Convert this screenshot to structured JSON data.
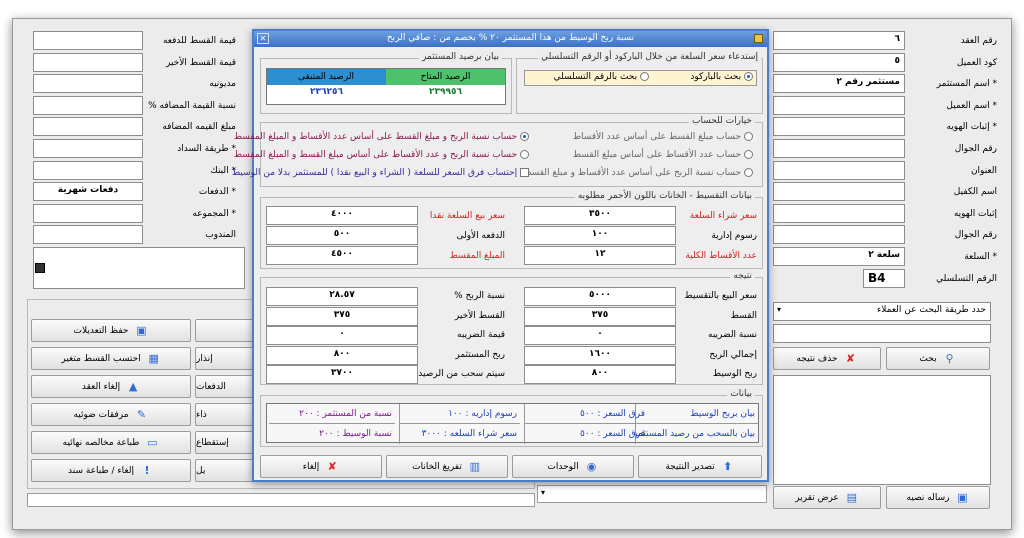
{
  "form": {
    "right_labels": [
      "رقم العقد",
      "كود العميل",
      "* اسم المستثمر",
      "* اسم العميل",
      "* إثبات الهويه",
      "رقم الجوال",
      "العنوان",
      "اسم الكفيل",
      "إثبات الهويه",
      "رقم الجوال",
      "* السلعة",
      "الرقم التسلسلي"
    ],
    "right_values": [
      "٦",
      "٥",
      "مستثمر رقم ٢",
      "",
      "",
      "",
      "",
      "",
      "",
      "",
      "سلعة ٢",
      "B4"
    ],
    "left_labels": [
      "قيمة القسط للدفعه",
      "قيمة القسط الأخير",
      "مديونيه",
      "نسبة القيمة المضافه %",
      "مبلغ القيمه المضافه",
      "* طريقة السداد",
      "* البنك",
      "* الدفعات",
      "* المجموعه",
      "المندوب"
    ],
    "left_values": [
      "",
      "",
      "",
      "",
      "",
      "",
      "",
      "دفعات شهرية",
      "",
      ""
    ],
    "search_method_placeholder": "حدد طريقة البحث عن العملاء",
    "search_button": "بحث",
    "delete_result_button": "حذف نتيجه",
    "send_message_button": "رساله نصيه",
    "show_report_button": "عرض تقرير"
  },
  "left_buttons": {
    "col1": [
      "حفظ التعديلات",
      "احتسب القسط متغير",
      "إلغاء العقد",
      "مرفقات ضوئيه",
      "طباعة مخالصه نهائيه",
      "إلغاء / طباعة سند"
    ],
    "col2": [
      "",
      "إنذار",
      "الدفعات",
      "ذاء",
      "إستقطاع",
      "يل"
    ]
  },
  "dialog": {
    "title": "نسبة ربح الوسيط من هذا المستثمر ٢٠ % بخصم من : صافي الربح",
    "serial_group": {
      "title": "إستدعاء سعر السلعة من خلال الباركود أو الرقم التسلسلي",
      "opt_barcode": "بحث بالباركود",
      "opt_serial": "بحث بالرقم التسلسلي"
    },
    "balance_group": {
      "title": "بيان برصيد المستثمر",
      "available_label": "الرصيد المتاح",
      "remaining_label": "الرصيد المتبقى",
      "available": "٢٣٩٩٥٦",
      "remaining": "٢٣٦٢٥٦"
    },
    "options_group": {
      "title": "خيارات للحساب",
      "opts": [
        "حساب مبلغ القسط على أساس عدد الأقساط",
        "حساب عدد الأقساط على أساس مبلغ القسط",
        "حساب نسبة الربح على أساس عدد الأقساط و مبلغ القسط",
        "حساب نسبة الربح و مبلغ القسط على أساس عدد الأقساط و المبلغ المقسط",
        "حساب نسبة الربح و عدد الأقساط على أساس مبلغ القسط و المبلغ المقسط",
        "إحتساب فرق السعر للسلعة ( الشراء و البيع نقدا ) للمستثمر بدلا من الوسيط"
      ]
    },
    "installment_group": {
      "title": "بيانات التقسيط - الخانات باللون الأحمر مطلوبه",
      "purchase_price_label": "سعر شراء السلعة",
      "purchase_price": "٣٥٠٠",
      "admin_fee_label": "رسوم إدارية",
      "admin_fee": "١٠٠",
      "count_label": "عدد الأقساط الكلية",
      "count": "١٢",
      "cash_price_label": "سعر بيع السلعة نقدا",
      "cash_price": "٤٠٠٠",
      "first_payment_label": "الدفعه الأولى",
      "first_payment": "٥٠٠",
      "financed_label": "المبلغ المقسط",
      "financed": "٤٥٠٠"
    },
    "result_group": {
      "title": "نتيجه",
      "sale_price_label": "سعر البيع بالتقسيط",
      "sale_price": "٥٠٠٠",
      "installment_label": "القسط",
      "installment": "٣٧٥",
      "tax_rate_label": "نسبة الضريبه",
      "tax_rate": "٠",
      "total_profit_label": "إجمالي الربح",
      "total_profit": "١٦٠٠",
      "broker_profit_label": "ربح الوسيط",
      "broker_profit": "٨٠٠",
      "profit_pct_label": "نسبة الربح %",
      "profit_pct": "٢٨.٥٧",
      "last_installment_label": "القسط الأخير",
      "last_installment": "٣٧٥",
      "tax_value_label": "قيمة الضريبه",
      "tax_value": "٠",
      "investor_profit_label": "ربح المستثمر",
      "investor_profit": "٨٠٠",
      "withdraw_label": "سيتم سحب من الرصيد",
      "withdraw": "٣٧٠٠"
    },
    "data_group": {
      "title": "بيانات",
      "row1": [
        "بيان بربح الوسيط",
        "فرق السعر : ٥٠٠",
        "رسوم إداريه : ١٠٠",
        "نسبة من المستثمر : ٢٠٠"
      ],
      "row2": [
        "بيان بالسحب من رصيد المستثمر",
        "فرق السعر : ٥٠٠",
        "سعر شراء السلعه : ٣٠٠٠",
        "نسبة الوسيط : ٢٠٠"
      ]
    },
    "buttons": {
      "export": "تصدير النتيجة",
      "units": "الوحدات",
      "clear": "تفريغ الخانات",
      "cancel": "إلغاء"
    }
  },
  "colors": {
    "accent": "#3a70c6",
    "available_header": "#4fc06b",
    "remaining_header": "#2d8fd0",
    "required": "#d32020"
  }
}
